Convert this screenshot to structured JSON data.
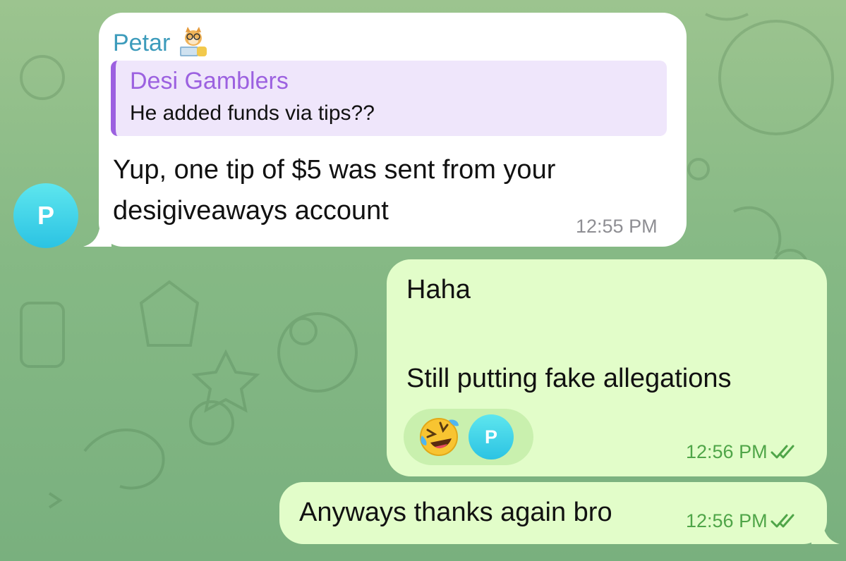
{
  "incoming_message": {
    "sender_name": "Petar",
    "sender_emoji_icon": "dog-laptop-icon",
    "reply": {
      "title": "Desi Gamblers",
      "text": "He added funds via tips??"
    },
    "text_line_1": "Yup, one tip of $5 was sent from your",
    "text_line_2": "desigiveaways account",
    "time": "12:55 PM",
    "avatar_letter": "P"
  },
  "outgoing_message_1": {
    "line_1": "Haha",
    "line_2": "Still putting fake allegations",
    "reaction_emoji_icon": "rolling-laughing-emoji-icon",
    "reaction_avatar_letter": "P",
    "time": "12:56 PM",
    "status_icon": "double-check-icon"
  },
  "outgoing_message_2": {
    "text": "Anyways thanks again bro",
    "time": "12:56 PM",
    "status_icon": "double-check-icon"
  },
  "colors": {
    "sender_name": "#3c9bbb",
    "reply_accent": "#9c61e0",
    "outgoing_bubble": "#e2fdc9",
    "outgoing_time": "#4fa548"
  }
}
